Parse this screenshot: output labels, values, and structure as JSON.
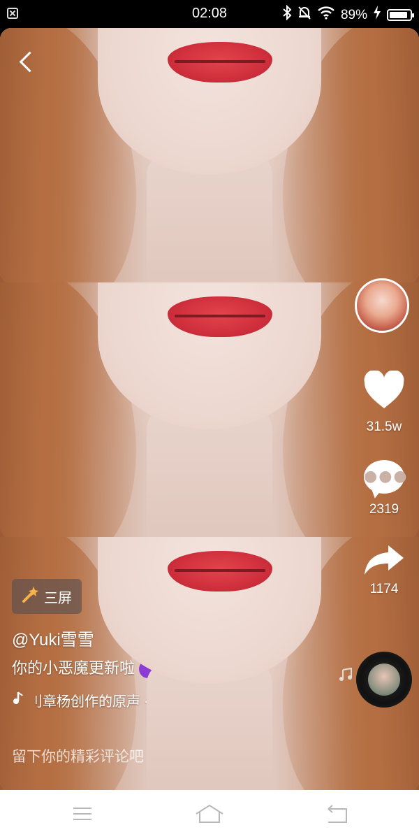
{
  "status_bar": {
    "time": "02:08",
    "battery_percent": "89%",
    "battery_level": 0.89,
    "icons": [
      "sim-off-icon",
      "bluetooth-icon",
      "notifications-off-icon",
      "wifi-icon",
      "battery-icon",
      "charging-icon"
    ]
  },
  "video": {
    "effect_tag": "三屏",
    "effect_icon": "magic-wand-icon",
    "username": "@Yuki雪雪",
    "description": "你的小恶魔更新啦",
    "description_emoji": "devil-emoji",
    "music": "刂章杨创作的原声 - 悟空刘",
    "music_icon": "music-note-icon"
  },
  "actions": {
    "likes": "31.5w",
    "comments": "2319",
    "shares": "1174"
  },
  "comment_input": {
    "placeholder": "留下你的精彩评论吧"
  },
  "colors": {
    "lip_red": "#cf2f3c",
    "overlay_text": "#ffffff",
    "nav_bar": "#ffffff"
  }
}
